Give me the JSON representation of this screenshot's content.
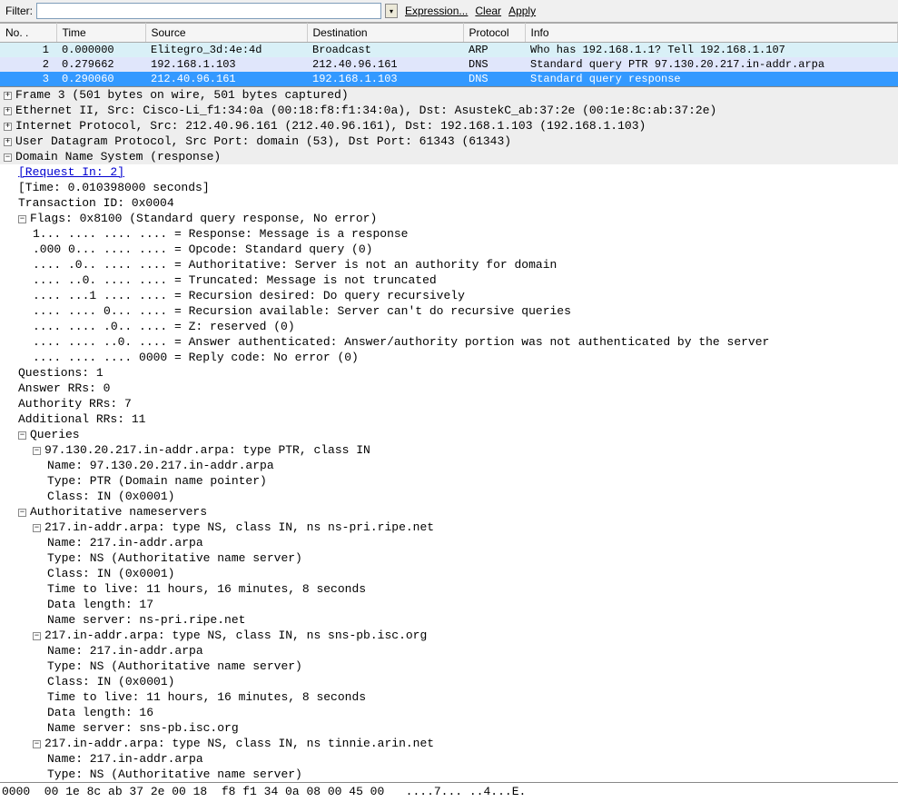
{
  "filter": {
    "label": "Filter:",
    "value": "",
    "expression": "Expression...",
    "clear": "Clear",
    "apply": "Apply"
  },
  "columns": {
    "no": "No. .",
    "time": "Time",
    "src": "Source",
    "dst": "Destination",
    "proto": "Protocol",
    "info": "Info"
  },
  "packets": [
    {
      "no": "1",
      "time": "0.000000",
      "src": "Elitegro_3d:4e:4d",
      "dst": "Broadcast",
      "proto": "ARP",
      "info": "Who has 192.168.1.1?  Tell 192.168.1.107"
    },
    {
      "no": "2",
      "time": "0.279662",
      "src": "192.168.1.103",
      "dst": "212.40.96.161",
      "proto": "DNS",
      "info": "Standard query PTR 97.130.20.217.in-addr.arpa"
    },
    {
      "no": "3",
      "time": "0.290060",
      "src": "212.40.96.161",
      "dst": "192.168.1.103",
      "proto": "DNS",
      "info": "Standard query response"
    }
  ],
  "details": {
    "frame": "Frame 3 (501 bytes on wire, 501 bytes captured)",
    "eth": "Ethernet II, Src: Cisco-Li_f1:34:0a (00:18:f8:f1:34:0a), Dst: AsustekC_ab:37:2e (00:1e:8c:ab:37:2e)",
    "ip": "Internet Protocol, Src: 212.40.96.161 (212.40.96.161), Dst: 192.168.1.103 (192.168.1.103)",
    "udp": "User Datagram Protocol, Src Port: domain (53), Dst Port: 61343 (61343)",
    "dns": "Domain Name System (response)",
    "request_in": "[Request In: 2]",
    "time_line": "[Time: 0.010398000 seconds]",
    "txid": "Transaction ID: 0x0004",
    "flags_header": "Flags: 0x8100 (Standard query response, No error)",
    "flag1": "1... .... .... .... = Response: Message is a response",
    "flag2": ".000 0... .... .... = Opcode: Standard query (0)",
    "flag3": ".... .0.. .... .... = Authoritative: Server is not an authority for domain",
    "flag4": ".... ..0. .... .... = Truncated: Message is not truncated",
    "flag5": ".... ...1 .... .... = Recursion desired: Do query recursively",
    "flag6": ".... .... 0... .... = Recursion available: Server can't do recursive queries",
    "flag7": ".... .... .0.. .... = Z: reserved (0)",
    "flag8": ".... .... ..0. .... = Answer authenticated: Answer/authority portion was not authenticated by the server",
    "flag9": ".... .... .... 0000 = Reply code: No error (0)",
    "questions": "Questions: 1",
    "answers": "Answer RRs: 0",
    "authority": "Authority RRs: 7",
    "additional": "Additional RRs: 11",
    "queries_label": "Queries",
    "q1_header": "97.130.20.217.in-addr.arpa: type PTR, class IN",
    "q1_name": "Name: 97.130.20.217.in-addr.arpa",
    "q1_type": "Type: PTR (Domain name pointer)",
    "q1_class": "Class: IN (0x0001)",
    "auth_label": "Authoritative nameservers",
    "a1_header": "217.in-addr.arpa: type NS, class IN, ns ns-pri.ripe.net",
    "a1_name": "Name: 217.in-addr.arpa",
    "a1_type": "Type: NS (Authoritative name server)",
    "a1_class": "Class: IN (0x0001)",
    "a1_ttl": "Time to live: 11 hours, 16 minutes, 8 seconds",
    "a1_len": "Data length: 17",
    "a1_ns": "Name server: ns-pri.ripe.net",
    "a2_header": "217.in-addr.arpa: type NS, class IN, ns sns-pb.isc.org",
    "a2_name": "Name: 217.in-addr.arpa",
    "a2_type": "Type: NS (Authoritative name server)",
    "a2_class": "Class: IN (0x0001)",
    "a2_ttl": "Time to live: 11 hours, 16 minutes, 8 seconds",
    "a2_len": "Data length: 16",
    "a2_ns": "Name server: sns-pb.isc.org",
    "a3_header": "217.in-addr.arpa: type NS, class IN, ns tinnie.arin.net",
    "a3_name": "Name: 217.in-addr.arpa",
    "a3_type": "Type: NS (Authoritative name server)"
  },
  "hex": "0000  00 1e 8c ab 37 2e 00 18  f8 f1 34 0a 08 00 45 00   ....7... ..4...E."
}
